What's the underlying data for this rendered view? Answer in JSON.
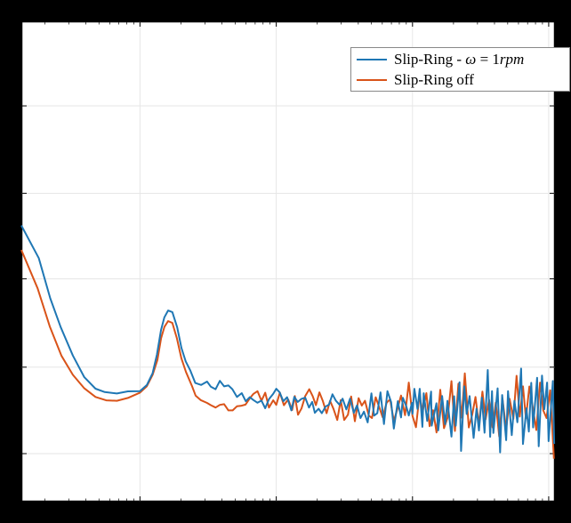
{
  "chart_data": {
    "type": "line",
    "ylim_rel": [
      0,
      1
    ],
    "xlim_rel": [
      0,
      1
    ],
    "legend": [
      "Slip-Ring - ω = 1rpm",
      "Slip-Ring off"
    ],
    "grid_x_rel": [
      0.2223,
      0.4777,
      0.733,
      0.9882
    ],
    "grid_y_rel": [
      0.1,
      0.28,
      0.464,
      0.642,
      0.824
    ],
    "series": [
      {
        "name": "Slip-Ring - ω = 1rpm",
        "color": "#1f77b4",
        "points_rel": [
          [
            0.0,
            0.575
          ],
          [
            0.0327,
            0.507
          ],
          [
            0.0541,
            0.4234
          ],
          [
            0.0737,
            0.3636
          ],
          [
            0.0965,
            0.3042
          ],
          [
            0.118,
            0.259
          ],
          [
            0.139,
            0.2351
          ],
          [
            0.1564,
            0.2281
          ],
          [
            0.179,
            0.2251
          ],
          [
            0.1996,
            0.2296
          ],
          [
            0.2223,
            0.2301
          ],
          [
            0.2354,
            0.2431
          ],
          [
            0.246,
            0.2675
          ],
          [
            0.254,
            0.306
          ],
          [
            0.2617,
            0.3569
          ],
          [
            0.268,
            0.3837
          ],
          [
            0.275,
            0.398
          ],
          [
            0.283,
            0.3947
          ],
          [
            0.292,
            0.3631
          ],
          [
            0.3,
            0.32
          ],
          [
            0.308,
            0.292
          ],
          [
            0.3167,
            0.273
          ],
          [
            0.326,
            0.247
          ],
          [
            0.337,
            0.243
          ],
          [
            0.348,
            0.25
          ],
          [
            0.355,
            0.2395
          ],
          [
            0.364,
            0.234
          ],
          [
            0.372,
            0.2515
          ],
          [
            0.38,
            0.24
          ],
          [
            0.388,
            0.242
          ],
          [
            0.3955,
            0.234
          ],
          [
            0.404,
            0.218
          ],
          [
            0.413,
            0.226
          ],
          [
            0.4205,
            0.209
          ],
          [
            0.428,
            0.2175
          ],
          [
            0.435,
            0.2115
          ],
          [
            0.4425,
            0.206
          ],
          [
            0.45,
            0.2104
          ],
          [
            0.457,
            0.1945
          ],
          [
            0.464,
            0.2136
          ],
          [
            0.472,
            0.2245
          ],
          [
            0.4777,
            0.235
          ],
          [
            0.484,
            0.2275
          ],
          [
            0.491,
            0.209
          ],
          [
            0.498,
            0.2175
          ],
          [
            0.506,
            0.19
          ],
          [
            0.5115,
            0.2182
          ],
          [
            0.518,
            0.2075
          ],
          [
            0.525,
            0.2141
          ],
          [
            0.532,
            0.2164
          ],
          [
            0.539,
            0.196
          ],
          [
            0.545,
            0.2075
          ],
          [
            0.55,
            0.185
          ],
          [
            0.557,
            0.1936
          ],
          [
            0.563,
            0.184
          ],
          [
            0.57,
            0.1978
          ],
          [
            0.5765,
            0.202
          ],
          [
            0.583,
            0.2235
          ],
          [
            0.5895,
            0.21
          ],
          [
            0.596,
            0.202
          ],
          [
            0.602,
            0.2145
          ],
          [
            0.609,
            0.192
          ],
          [
            0.616,
            0.2144
          ],
          [
            0.623,
            0.185
          ],
          [
            0.629,
            0.2004
          ],
          [
            0.6355,
            0.174
          ],
          [
            0.642,
            0.1875
          ],
          [
            0.649,
            0.165
          ],
          [
            0.656,
            0.2255
          ],
          [
            0.661,
            0.179
          ],
          [
            0.667,
            0.184
          ],
          [
            0.673,
            0.2275
          ],
          [
            0.6795,
            0.1614
          ],
          [
            0.686,
            0.23
          ],
          [
            0.693,
            0.207
          ],
          [
            0.698,
            0.1521
          ],
          [
            0.7055,
            0.2093
          ],
          [
            0.7115,
            0.1754
          ],
          [
            0.715,
            0.2162
          ],
          [
            0.7215,
            0.198
          ],
          [
            0.726,
            0.1795
          ],
          [
            0.732,
            0.2055
          ],
          [
            0.733,
            0.183
          ],
          [
            0.7365,
            0.235
          ],
          [
            0.7423,
            0.193
          ],
          [
            0.7465,
            0.235
          ],
          [
            0.7515,
            0.1558
          ],
          [
            0.754,
            0.2257
          ],
          [
            0.7605,
            0.168
          ],
          [
            0.7678,
            0.229
          ],
          [
            0.769,
            0.1582
          ],
          [
            0.7778,
            0.2049
          ],
          [
            0.7812,
            0.1483
          ],
          [
            0.7885,
            0.2198
          ],
          [
            0.7942,
            0.1612
          ],
          [
            0.7985,
            0.21
          ],
          [
            0.806,
            0.1354
          ],
          [
            0.811,
            0.2195
          ],
          [
            0.814,
            0.158
          ],
          [
            0.8212,
            0.2485
          ],
          [
            0.824,
            0.1055
          ],
          [
            0.83,
            0.24
          ],
          [
            0.8345,
            0.1824
          ],
          [
            0.84,
            0.2198
          ],
          [
            0.8475,
            0.1325
          ],
          [
            0.853,
            0.1935
          ],
          [
            0.8575,
            0.1481
          ],
          [
            0.863,
            0.2165
          ],
          [
            0.868,
            0.1435
          ],
          [
            0.874,
            0.274
          ],
          [
            0.8785,
            0.135
          ],
          [
            0.882,
            0.23
          ],
          [
            0.8845,
            0.143
          ],
          [
            0.8925,
            0.236
          ],
          [
            0.8972,
            0.1025
          ],
          [
            0.901,
            0.222
          ],
          [
            0.9085,
            0.128
          ],
          [
            0.912,
            0.23
          ],
          [
            0.919,
            0.1386
          ],
          [
            0.924,
            0.21
          ],
          [
            0.9295,
            0.1654
          ],
          [
            0.9365,
            0.277
          ],
          [
            0.94,
            0.12
          ],
          [
            0.9465,
            0.1945
          ],
          [
            0.951,
            0.146
          ],
          [
            0.9555,
            0.2475
          ],
          [
            0.959,
            0.1545
          ],
          [
            0.9665,
            0.258
          ],
          [
            0.9695,
            0.1154
          ],
          [
            0.9756,
            0.2625
          ],
          [
            0.98,
            0.1924
          ],
          [
            0.9852,
            0.248
          ],
          [
            0.988,
            0.126
          ],
          [
            0.996,
            0.2512
          ],
          [
            0.9985,
            0.1204
          ]
        ]
      },
      {
        "name": "Slip-Ring off",
        "color": "#d95319",
        "points_rel": [
          [
            0.0,
            0.524
          ],
          [
            0.0305,
            0.444
          ],
          [
            0.0535,
            0.364
          ],
          [
            0.075,
            0.304
          ],
          [
            0.0965,
            0.264
          ],
          [
            0.118,
            0.236
          ],
          [
            0.139,
            0.218
          ],
          [
            0.159,
            0.211
          ],
          [
            0.179,
            0.21
          ],
          [
            0.1996,
            0.216
          ],
          [
            0.2223,
            0.227
          ],
          [
            0.235,
            0.24
          ],
          [
            0.246,
            0.264
          ],
          [
            0.255,
            0.295
          ],
          [
            0.2618,
            0.34
          ],
          [
            0.2682,
            0.364
          ],
          [
            0.275,
            0.376
          ],
          [
            0.283,
            0.372
          ],
          [
            0.2915,
            0.34
          ],
          [
            0.3,
            0.298
          ],
          [
            0.3085,
            0.27
          ],
          [
            0.32,
            0.24
          ],
          [
            0.3265,
            0.221
          ],
          [
            0.336,
            0.2115
          ],
          [
            0.348,
            0.2055
          ],
          [
            0.355,
            0.201
          ],
          [
            0.364,
            0.196
          ],
          [
            0.372,
            0.2015
          ],
          [
            0.38,
            0.203
          ],
          [
            0.388,
            0.19
          ],
          [
            0.396,
            0.19
          ],
          [
            0.404,
            0.1985
          ],
          [
            0.4115,
            0.1995
          ],
          [
            0.42,
            0.202
          ],
          [
            0.428,
            0.215
          ],
          [
            0.435,
            0.2245
          ],
          [
            0.4425,
            0.23
          ],
          [
            0.45,
            0.21
          ],
          [
            0.457,
            0.2268
          ],
          [
            0.464,
            0.196
          ],
          [
            0.472,
            0.2112
          ],
          [
            0.4777,
            0.2014
          ],
          [
            0.4845,
            0.227
          ],
          [
            0.492,
            0.2008
          ],
          [
            0.5,
            0.213
          ],
          [
            0.5075,
            0.1908
          ],
          [
            0.5125,
            0.22
          ],
          [
            0.5185,
            0.181
          ],
          [
            0.525,
            0.194
          ],
          [
            0.532,
            0.22
          ],
          [
            0.5395,
            0.234
          ],
          [
            0.546,
            0.2196
          ],
          [
            0.552,
            0.201
          ],
          [
            0.5585,
            0.2276
          ],
          [
            0.565,
            0.2095
          ],
          [
            0.572,
            0.184
          ],
          [
            0.5785,
            0.21
          ],
          [
            0.585,
            0.193
          ],
          [
            0.592,
            0.17
          ],
          [
            0.5985,
            0.2115
          ],
          [
            0.605,
            0.17
          ],
          [
            0.612,
            0.181
          ],
          [
            0.618,
            0.219
          ],
          [
            0.625,
            0.1675
          ],
          [
            0.632,
            0.2155
          ],
          [
            0.638,
            0.2
          ],
          [
            0.644,
            0.21
          ],
          [
            0.651,
            0.1795
          ],
          [
            0.657,
            0.174
          ],
          [
            0.664,
            0.2175
          ],
          [
            0.671,
            0.1955
          ],
          [
            0.677,
            0.176
          ],
          [
            0.6845,
            0.206
          ],
          [
            0.691,
            0.213
          ],
          [
            0.698,
            0.168
          ],
          [
            0.705,
            0.194
          ],
          [
            0.7115,
            0.221
          ],
          [
            0.719,
            0.18
          ],
          [
            0.726,
            0.248
          ],
          [
            0.733,
            0.1785
          ],
          [
            0.7395,
            0.155
          ],
          [
            0.746,
            0.2208
          ],
          [
            0.752,
            0.188
          ],
          [
            0.759,
            0.226
          ],
          [
            0.765,
            0.157
          ],
          [
            0.7715,
            0.1904
          ],
          [
            0.778,
            0.144
          ],
          [
            0.785,
            0.233
          ],
          [
            0.792,
            0.153
          ],
          [
            0.799,
            0.176
          ],
          [
            0.806,
            0.251
          ],
          [
            0.8125,
            0.1473
          ],
          [
            0.819,
            0.2455
          ],
          [
            0.825,
            0.175
          ],
          [
            0.831,
            0.267
          ],
          [
            0.8385,
            0.1544
          ],
          [
            0.845,
            0.1815
          ],
          [
            0.851,
            0.218
          ],
          [
            0.8575,
            0.16
          ],
          [
            0.864,
            0.229
          ],
          [
            0.87,
            0.1715
          ],
          [
            0.8765,
            0.212
          ],
          [
            0.883,
            0.1545
          ],
          [
            0.889,
            0.2062
          ],
          [
            0.8955,
            0.1355
          ],
          [
            0.9015,
            0.2152
          ],
          [
            0.9085,
            0.151
          ],
          [
            0.915,
            0.214
          ],
          [
            0.922,
            0.1725
          ],
          [
            0.928,
            0.262
          ],
          [
            0.934,
            0.177
          ],
          [
            0.94,
            0.24
          ],
          [
            0.9455,
            0.1736
          ],
          [
            0.952,
            0.2399
          ],
          [
            0.958,
            0.1987
          ],
          [
            0.965,
            0.149
          ],
          [
            0.972,
            0.248
          ],
          [
            0.978,
            0.19
          ],
          [
            0.9842,
            0.174
          ],
          [
            0.991,
            0.232
          ],
          [
            0.998,
            0.0895
          ]
        ]
      }
    ]
  },
  "legend_on_html": "Slip-Ring - <i>ω</i> = 1<i>rpm</i>",
  "legend_off_html": "Slip-Ring off"
}
